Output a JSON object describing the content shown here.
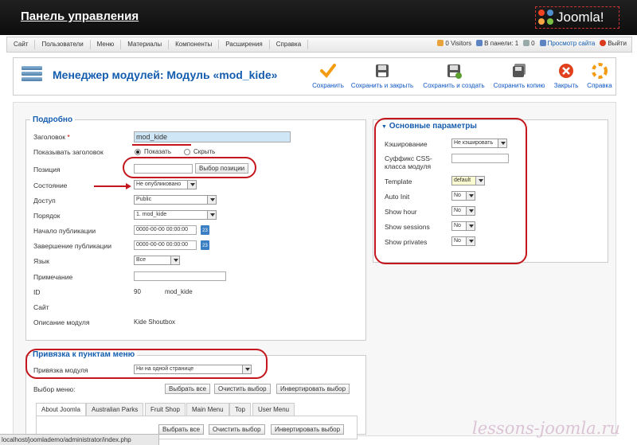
{
  "header": {
    "title": "Панель управления",
    "logo_text": "Joomla!"
  },
  "menu": {
    "items": [
      "Сайт",
      "Пользователи",
      "Меню",
      "Материалы",
      "Компоненты",
      "Расширения",
      "Справка"
    ]
  },
  "status": {
    "visitors": "0 Visitors",
    "in_panel": "В панели: 1",
    "messages": "0",
    "view_site": "Просмотр сайта",
    "logout": "Выйти"
  },
  "toolbar": {
    "page_title": "Менеджер модулей: Модуль «mod_kide»",
    "buttons": {
      "save": "Сохранить",
      "save_close": "Сохранить и закрыть",
      "save_new": "Сохранить и создать",
      "save_copy": "Сохранить копию",
      "close": "Закрыть",
      "help": "Справка"
    }
  },
  "details": {
    "legend": "Подробно",
    "title_label": "Заголовок",
    "title_required": "*",
    "title_value": "mod_kide",
    "show_title_label": "Показывать заголовок",
    "show_option": "Показать",
    "hide_option": "Скрыть",
    "position_label": "Позиция",
    "position_value": "",
    "position_button": "Выбор позиции",
    "state_label": "Состояние",
    "state_value": "Не опубликовано",
    "access_label": "Доступ",
    "access_value": "Public",
    "order_label": "Порядок",
    "order_value": "1. mod_kide",
    "publish_up_label": "Начало публикации",
    "publish_up_value": "0000-00-00 00:00:00",
    "publish_down_label": "Завершение публикации",
    "publish_down_value": "0000-00-00 00:00:00",
    "calendar_day": "23",
    "language_label": "Язык",
    "language_value": "Все",
    "note_label": "Примечание",
    "note_value": "",
    "id_label": "ID",
    "id_value": "90",
    "id_module": "mod_kide",
    "site_label": "Сайт",
    "desc_label": "Описание модуля",
    "desc_value": "Kide Shoutbox"
  },
  "params": {
    "legend": "Основные параметры",
    "caching_label": "Кэширование",
    "caching_value": "Не кэшировать",
    "css_suffix_label_1": "Суффикс CSS-",
    "css_suffix_label_2": "класса модуля",
    "template_label": "Template",
    "template_value": "default",
    "auto_init_label": "Auto Init",
    "auto_init_value": "No",
    "show_hour_label": "Show hour",
    "show_hour_value": "No",
    "show_sessions_label": "Show sessions",
    "show_sessions_value": "No",
    "show_privates_label": "Show privates",
    "show_privates_value": "No"
  },
  "assignment": {
    "legend": "Привязка к пунктам меню",
    "label": "Привязка модуля",
    "value": "Ни на одной странице",
    "menu_select_label": "Выбор меню:",
    "select_all": "Выбрать все",
    "clear": "Очистить выбор",
    "invert": "Инвертировать выбор",
    "tabs": [
      "About Joomla",
      "Australian Parks",
      "Fruit Shop",
      "Main Menu",
      "Top",
      "User Menu"
    ]
  },
  "statusbar": "localhost/joomlademo/administrator/index.php",
  "watermark": "lessons-joomla.ru",
  "colors": {
    "accent": "#135cae",
    "annotation": "#c4161c"
  }
}
